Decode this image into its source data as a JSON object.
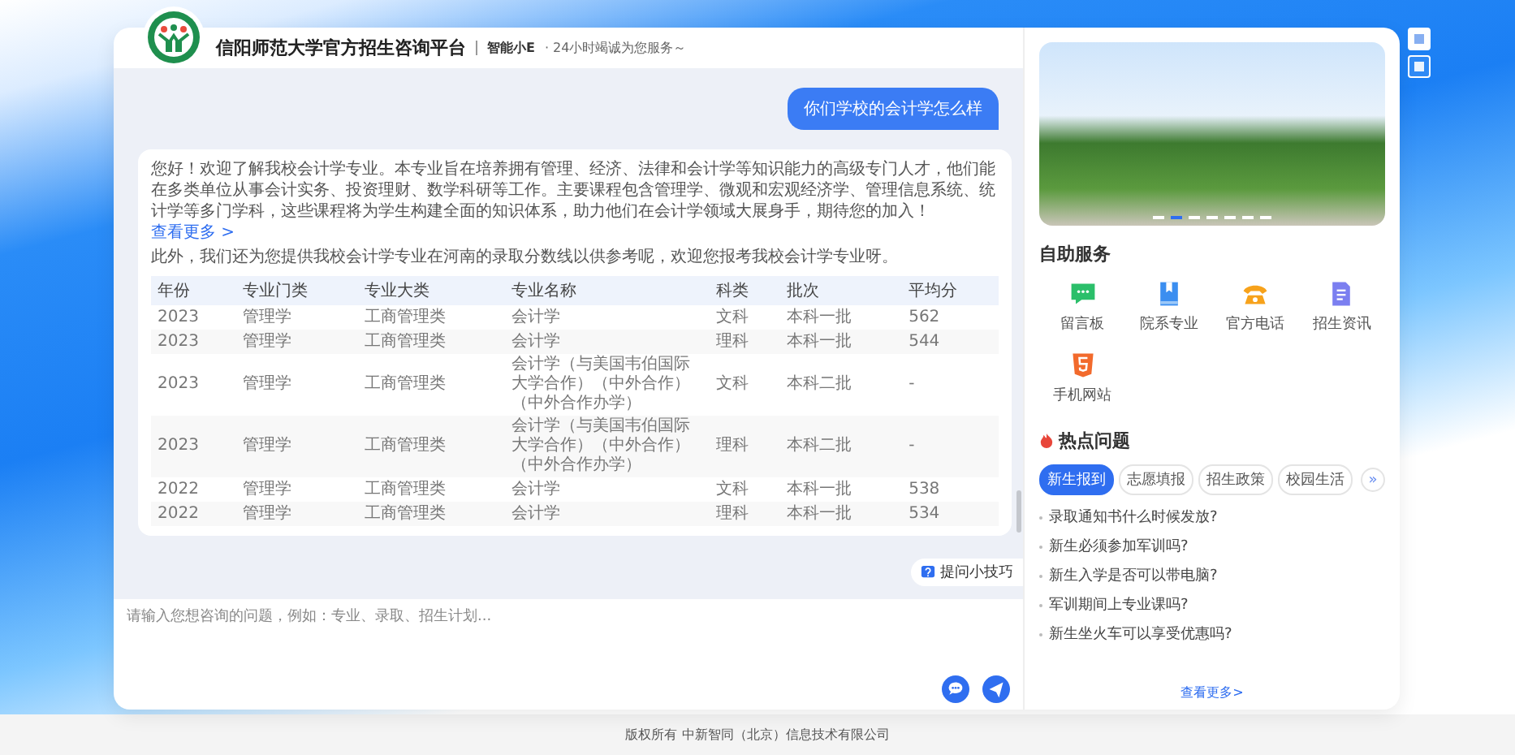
{
  "header": {
    "title": "信阳师范大学官方招生咨询平台",
    "assistant_name": "智能小E",
    "tagline": "· 24小时竭诚为您服务～"
  },
  "side_buttons": [
    {
      "selected": false
    },
    {
      "selected": true
    }
  ],
  "chat": {
    "messages": [
      {
        "kind": "user",
        "text": "你们学校的会计学怎么样"
      },
      {
        "kind": "bot",
        "paragraphs": [
          "您好！欢迎了解我校会计学专业。本专业旨在培养拥有管理、经济、法律和会计学等知识能力的高级专门人才，他们能在多类单位从事会计实务、投资理财、数学科研等工作。主要课程包含管理学、微观和宏观经济学、管理信息系统、统计学等多门学科，这些课程将为学生构建全面的知识体系，助力他们在会计学领域大展身手，期待您的加入！",
          "此外，我们还为您提供我校会计学专业在河南的录取分数线以供参考呢，欢迎您报考我校会计学专业呀。"
        ],
        "more_link": "查看更多 >",
        "table": {
          "columns": [
            "年份",
            "专业门类",
            "专业大类",
            "专业名称",
            "科类",
            "批次",
            "平均分"
          ],
          "rows": [
            [
              "2023",
              "管理学",
              "工商管理类",
              "会计学",
              "文科",
              "本科一批",
              "562"
            ],
            [
              "2023",
              "管理学",
              "工商管理类",
              "会计学",
              "理科",
              "本科一批",
              "544"
            ],
            [
              "2023",
              "管理学",
              "工商管理类",
              "会计学（与美国韦伯国际大学合作）（中外合作）（中外合作办学）",
              "文科",
              "本科二批",
              "-"
            ],
            [
              "2023",
              "管理学",
              "工商管理类",
              "会计学（与美国韦伯国际大学合作）（中外合作）（中外合作办学）",
              "理科",
              "本科二批",
              "-"
            ],
            [
              "2022",
              "管理学",
              "工商管理类",
              "会计学",
              "文科",
              "本科一批",
              "538"
            ],
            [
              "2022",
              "管理学",
              "工商管理类",
              "会计学",
              "理科",
              "本科一批",
              "534"
            ]
          ]
        }
      }
    ],
    "tips_button": "提问小技巧",
    "input": {
      "placeholder": "请输入您想咨询的问题，例如：专业、录取、招生计划..."
    }
  },
  "sidebar": {
    "carousel_dots": [
      {
        "selected": false
      },
      {
        "selected": true
      },
      {
        "selected": false
      },
      {
        "selected": false
      },
      {
        "selected": false
      },
      {
        "selected": false
      },
      {
        "selected": false
      }
    ],
    "services_title": "自助服务",
    "services": [
      {
        "kind": "message",
        "label": "留言板"
      },
      {
        "kind": "book",
        "label": "院系专业"
      },
      {
        "kind": "phone",
        "label": "官方电话"
      },
      {
        "kind": "document",
        "label": "招生资讯"
      },
      {
        "kind": "html5",
        "label": "手机网站"
      }
    ],
    "hot_title": "热点问题",
    "hot_tabs": [
      {
        "label": "新生报到",
        "selected": true
      },
      {
        "label": "志愿填报",
        "selected": false
      },
      {
        "label": "招生政策",
        "selected": false
      },
      {
        "label": "校园生活",
        "selected": false
      }
    ],
    "next_tab": "»",
    "questions": [
      "录取通知书什么时候发放?",
      "新生必须参加军训吗?",
      "新生入学是否可以带电脑?",
      "军训期间上专业课吗?",
      "新生坐火车可以享受优惠吗?"
    ],
    "more_link": "查看更多>"
  },
  "footer": "版权所有 中新智同（北京）信息技术有限公司"
}
